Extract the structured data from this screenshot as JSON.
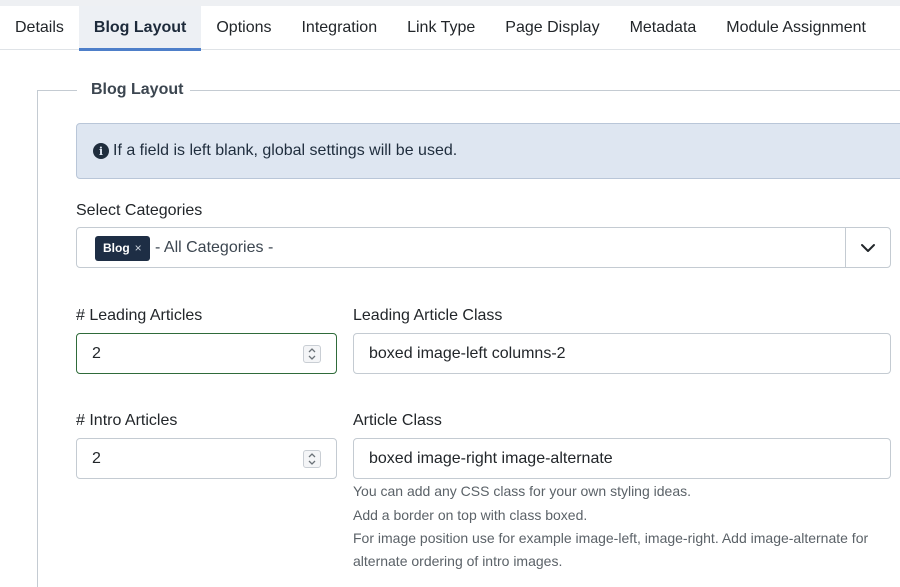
{
  "tabs": [
    {
      "label": "Details",
      "active": false
    },
    {
      "label": "Blog Layout",
      "active": true
    },
    {
      "label": "Options",
      "active": false
    },
    {
      "label": "Integration",
      "active": false
    },
    {
      "label": "Link Type",
      "active": false
    },
    {
      "label": "Page Display",
      "active": false
    },
    {
      "label": "Metadata",
      "active": false
    },
    {
      "label": "Module Assignment",
      "active": false
    }
  ],
  "fieldset": {
    "legend": "Blog Layout"
  },
  "alert": {
    "icon": "info-circle-icon",
    "text": "If a field is left blank, global settings will be used."
  },
  "categories": {
    "label": "Select Categories",
    "chip": "Blog",
    "chip_remove": "×",
    "placeholder": "- All Categories -"
  },
  "leading": {
    "label": "# Leading Articles",
    "value": "2",
    "class_label": "Leading Article Class",
    "class_value": "boxed image-left columns-2"
  },
  "intro": {
    "label": "# Intro Articles",
    "value": "2",
    "class_label": "Article Class",
    "class_value": "boxed image-right image-alternate"
  },
  "help": [
    "You can add any CSS class for your own styling ideas.",
    "Add a border on top with class boxed.",
    "For image position use for example image-left, image-right. Add image-alternate for",
    "alternate ordering of intro images."
  ],
  "colors": {
    "active_tab_underline": "#4e7fc9",
    "alert_bg": "#dee6f1",
    "chip_bg": "#1e2e45",
    "focus_border": "#2f6b3a"
  }
}
